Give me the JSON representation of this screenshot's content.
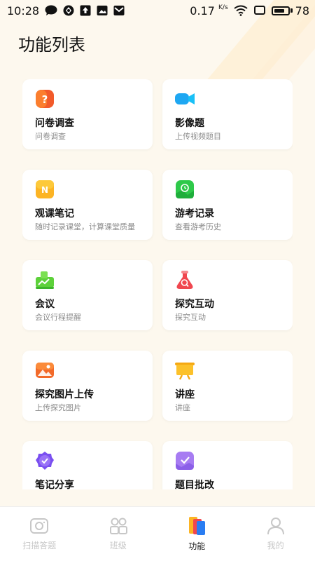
{
  "status_bar": {
    "time": "10:28",
    "net_speed_value": "0.17",
    "net_speed_unit": "K/s",
    "battery_level": "78",
    "battery_fraction": 0.78
  },
  "page": {
    "title": "功能列表"
  },
  "features": [
    {
      "title": "问卷调查",
      "subtitle": "问卷调查",
      "icon": "questionnaire-icon",
      "color": "#f25a2a"
    },
    {
      "title": "影像题",
      "subtitle": "上传视频题目",
      "icon": "video-camera-icon",
      "color": "#1ea7f2"
    },
    {
      "title": "观课笔记",
      "subtitle": "随时记录课堂，计算课堂质量",
      "icon": "note-n-icon",
      "color": "#fcb424"
    },
    {
      "title": "游考记录",
      "subtitle": "查看游考历史",
      "icon": "tour-record-icon",
      "color": "#2ec94a"
    },
    {
      "title": "会议",
      "subtitle": "会议行程提醒",
      "icon": "meeting-chart-icon",
      "color": "#5dd13a"
    },
    {
      "title": "探究互动",
      "subtitle": "探究互动",
      "icon": "flask-icon",
      "color": "#f0474f"
    },
    {
      "title": "探究图片上传",
      "subtitle": "上传探究图片",
      "icon": "picture-upload-icon",
      "color": "#f26a2a"
    },
    {
      "title": "讲座",
      "subtitle": "讲座",
      "icon": "lecture-board-icon",
      "color": "#fcc12a"
    },
    {
      "title": "笔记分享",
      "subtitle": "",
      "icon": "share-badge-icon",
      "color": "#7a4ff0"
    },
    {
      "title": "题目批改",
      "subtitle": "",
      "icon": "correction-icon",
      "color": "#a77cf2"
    }
  ],
  "tabs": [
    {
      "label": "扫描答题",
      "icon": "camera-scan-icon",
      "active": false
    },
    {
      "label": "班级",
      "icon": "class-people-icon",
      "active": false
    },
    {
      "label": "功能",
      "icon": "function-cards-icon",
      "active": true
    },
    {
      "label": "我的",
      "icon": "profile-icon",
      "active": false
    }
  ]
}
